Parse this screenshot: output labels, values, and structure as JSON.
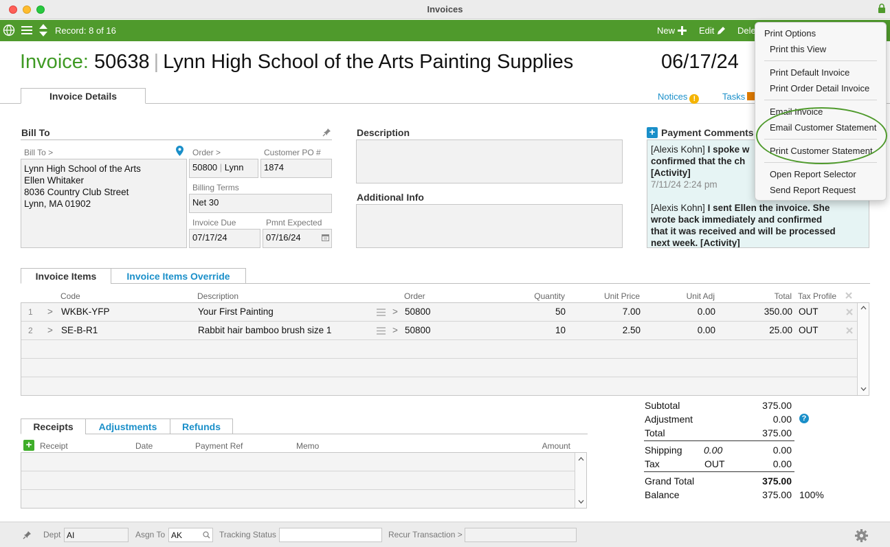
{
  "window": {
    "title": "Invoices"
  },
  "toolbar": {
    "record": "Record: 8 of 16",
    "new_label": "New",
    "edit_label": "Edit",
    "delete_label": "Dele"
  },
  "header": {
    "invoice_prefix": "Invoice:",
    "invoice_number": "50638",
    "customer_name": "Lynn High School of the Arts Painting Supplies",
    "date": "06/17/24"
  },
  "tabs": {
    "details": "Invoice Details",
    "notices": "Notices",
    "notices_badge": "!",
    "tasks": "Tasks"
  },
  "bill_to": {
    "section_title": "Bill To",
    "label": "Bill To >",
    "address": "Lynn High School of the Arts\nEllen Whitaker\n8036 Country Club Street\nLynn, MA 01902",
    "order_label": "Order >",
    "order_value": "50800",
    "order_contact": "Lynn",
    "customer_po_label": "Customer PO #",
    "customer_po": "1874",
    "billing_terms_label": "Billing Terms",
    "billing_terms": "Net 30",
    "invoice_due_label": "Invoice Due",
    "invoice_due": "07/17/24",
    "pmnt_expected_label": "Pmnt Expected",
    "pmnt_expected": "07/16/24"
  },
  "description": {
    "title": "Description",
    "additional_info_title": "Additional Info"
  },
  "payment_comments": {
    "title": "Payment Comments",
    "entry1_author": "[Alexis Kohn]",
    "entry1_text_a": "I spoke w",
    "entry1_text_b": "confirmed that the ch",
    "entry1_tag": "[Activity]",
    "entry1_date": "7/11/24  2:24 pm",
    "entry2_author": "[Alexis Kohn]",
    "entry2_text_a": "I sent Ellen the invoice. She",
    "entry2_text_b": "wrote back immediately and confirmed",
    "entry2_text_c": "that it was received and will be processed",
    "entry2_text_d": "next week. [Activity]"
  },
  "items_tabs": {
    "items": "Invoice Items",
    "override": "Invoice Items Override"
  },
  "items_columns": {
    "code": "Code",
    "description": "Description",
    "order": "Order",
    "quantity": "Quantity",
    "unit_price": "Unit Price",
    "unit_adj": "Unit Adj",
    "total": "Total",
    "tax_profile": "Tax Profile"
  },
  "items": [
    {
      "num": "1",
      "code": "WKBK-YFP",
      "description": "Your First Painting",
      "order": "50800",
      "quantity": "50",
      "unit_price": "7.00",
      "unit_adj": "0.00",
      "total": "350.00",
      "tax": "OUT"
    },
    {
      "num": "2",
      "code": "SE-B-R1",
      "description": "Rabbit hair bamboo brush size 1",
      "order": "50800",
      "quantity": "10",
      "unit_price": "2.50",
      "unit_adj": "0.00",
      "total": "25.00",
      "tax": "OUT"
    }
  ],
  "receipts_tabs": {
    "receipts": "Receipts",
    "adjustments": "Adjustments",
    "refunds": "Refunds"
  },
  "receipts_columns": {
    "receipt": "Receipt",
    "date": "Date",
    "payment_ref": "Payment Ref",
    "memo": "Memo",
    "amount": "Amount"
  },
  "totals": {
    "subtotal_label": "Subtotal",
    "subtotal": "375.00",
    "adjustment_label": "Adjustment",
    "adjustment": "0.00",
    "total_label": "Total",
    "total": "375.00",
    "shipping_label": "Shipping",
    "shipping_input": "0.00",
    "shipping": "0.00",
    "tax_label": "Tax",
    "tax_profile": "OUT",
    "tax": "0.00",
    "grand_total_label": "Grand Total",
    "grand_total": "375.00",
    "balance_label": "Balance",
    "balance": "375.00",
    "balance_pct": "100%"
  },
  "bottom": {
    "dept_label": "Dept",
    "dept": "AI",
    "asgn_label": "Asgn To",
    "asgn": "AK",
    "tracking_label": "Tracking Status",
    "tracking": "",
    "recur_label": "Recur Transaction >",
    "recur": ""
  },
  "menu": {
    "header": "Print Options",
    "items": [
      "Print this View",
      "Print Default Invoice",
      "Print Order Detail Invoice",
      "Email Invoice",
      "Email Customer Statement",
      "Print Customer Statement",
      "Open Report Selector",
      "Send Report Request"
    ]
  },
  "colors": {
    "accent_green": "#4f9a2c",
    "link_blue": "#1a8fc9",
    "title_green": "#3f9a24"
  }
}
